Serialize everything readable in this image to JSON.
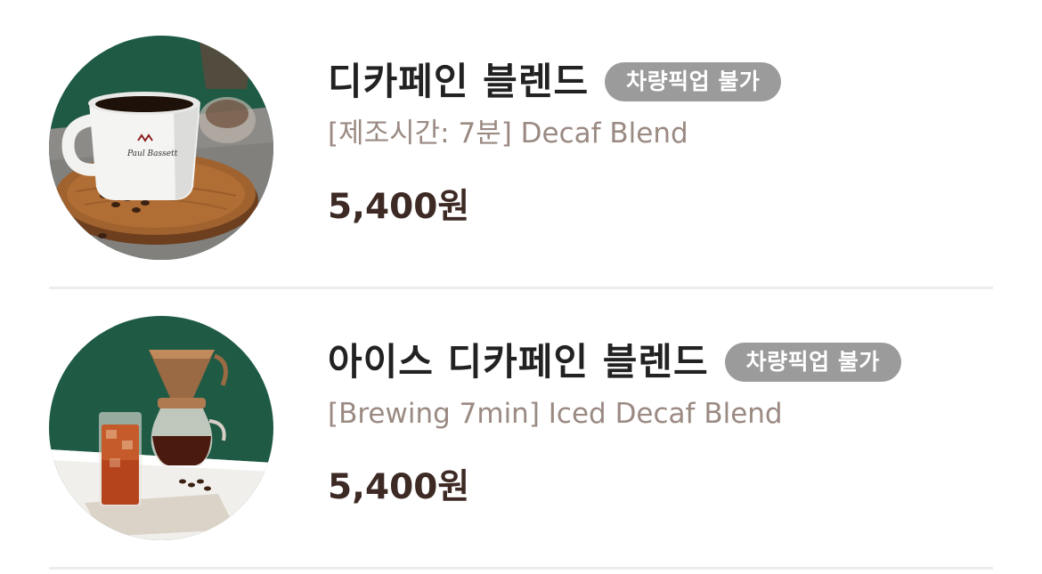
{
  "menu": {
    "items": [
      {
        "name": "디카페인 블렌드",
        "badge": "차량픽업 불가",
        "description": "[제조시간: 7분] Decaf Blend",
        "price": "5,400원",
        "image": "decaf-blend-mug-photo"
      },
      {
        "name": "아이스 디카페인 블렌드",
        "badge": "차량픽업 불가",
        "description": "[Brewing 7min] Iced Decaf Blend",
        "price": "5,400원",
        "image": "iced-decaf-blend-photo"
      }
    ]
  },
  "colors": {
    "name_text": "#222222",
    "description_text": "#9a8a82",
    "price_text": "#3d2a25",
    "badge_background": "#9b9b9b",
    "divider": "#ececec"
  }
}
